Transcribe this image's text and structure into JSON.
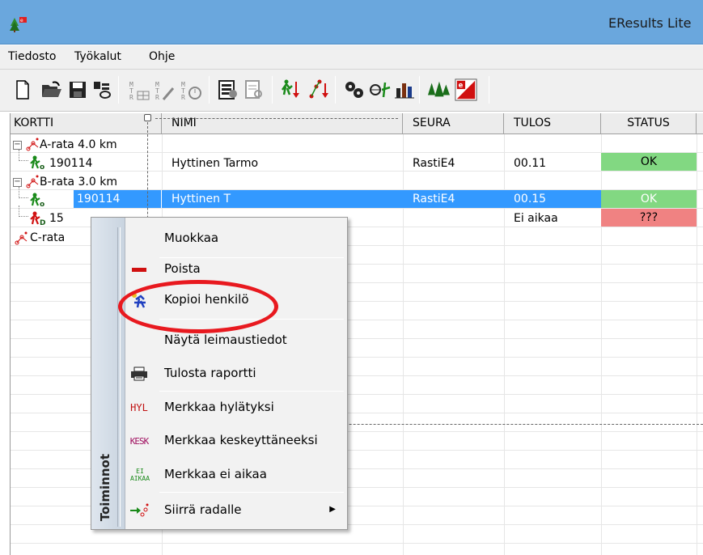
{
  "window": {
    "title": "EResults Lite"
  },
  "colors": {
    "titlebar": "#6aa7dd",
    "selection": "#3399ff",
    "status_ok": "#82d882",
    "status_bad": "#f08282",
    "highlight_ring": "#e8191f"
  },
  "menu": {
    "file": "Tiedosto",
    "tools": "Työkalut",
    "help": "Ohje"
  },
  "toolbar": {
    "buttons": [
      "new-file-icon",
      "open-folder-icon",
      "save-icon",
      "import-icon",
      "table-edit-icon",
      "pencil-edit-icon",
      "clock-edit-icon",
      "print-preview-icon",
      "document-search-icon",
      "sort-runner-icon",
      "sort-course-icon",
      "settings-gears-icon",
      "split-time-icon",
      "bar-chart-icon",
      "trees-icon",
      "eresults-logo-icon"
    ]
  },
  "grid": {
    "headers": {
      "kortti": "KORTTI",
      "nimi": "NIMI",
      "seura": "SEURA",
      "tulos": "TULOS",
      "status": "STATUS"
    },
    "courses": [
      {
        "label": "A-rata 4.0 km",
        "toggle": "−"
      },
      {
        "label": "B-rata 3.0 km",
        "toggle": "−"
      },
      {
        "label": "C-rata"
      }
    ],
    "rows": [
      {
        "card": "190114",
        "name": "Hyttinen Tarmo",
        "club": "RastiE4",
        "result": "00.11",
        "status": "OK"
      },
      {
        "card": "190114",
        "name": "Hyttinen T",
        "club": "RastiE4",
        "result": "00.15",
        "status": "OK"
      },
      {
        "card": "15",
        "name": "",
        "club": "",
        "result": "Ei aikaa",
        "status": "???"
      }
    ]
  },
  "context_menu": {
    "side_label": "Toiminnot",
    "items": [
      {
        "label": "Muokkaa",
        "icon": ""
      },
      {
        "label": "Poista",
        "icon": "delete-icon"
      },
      {
        "label": "Kopioi henkilö",
        "icon": "copy-person-icon"
      },
      {
        "label": "Näytä leimaustiedot",
        "icon": ""
      },
      {
        "label": "Tulosta raportti",
        "icon": "printer-icon"
      },
      {
        "label": "Merkkaa hylätyksi",
        "icon": "hyl-icon",
        "icon_text": "HYL"
      },
      {
        "label": "Merkkaa keskeyttäneeksi",
        "icon": "kesk-icon",
        "icon_text": "KESK"
      },
      {
        "label": "Merkkaa ei aikaa",
        "icon": "ei-aikaa-icon",
        "icon_text": "EI AIKAA"
      },
      {
        "label": "Siirrä radalle",
        "icon": "move-course-icon",
        "submenu": "▶"
      }
    ]
  }
}
